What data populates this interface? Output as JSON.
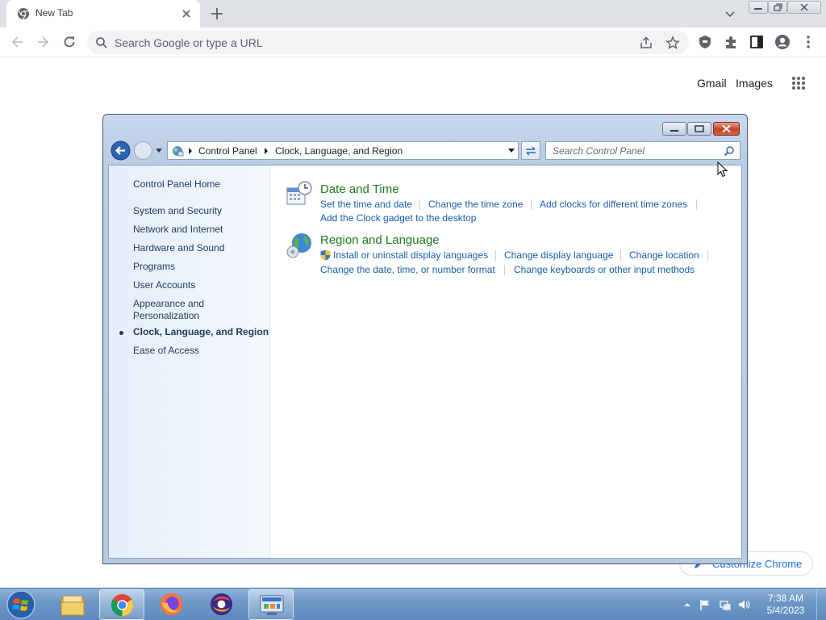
{
  "browser": {
    "tab": {
      "title": "New Tab",
      "favicon": "chrome-icon"
    },
    "omnibox": {
      "placeholder": "Search Google or type a URL"
    },
    "ntp": {
      "gmail": "Gmail",
      "images": "Images",
      "customize": "Customize Chrome"
    }
  },
  "cp": {
    "breadcrumb": [
      "Control Panel",
      "Clock, Language, and Region"
    ],
    "search_placeholder": "Search Control Panel",
    "sidebar": {
      "home": "Control Panel Home",
      "items": [
        "System and Security",
        "Network and Internet",
        "Hardware and Sound",
        "Programs",
        "User Accounts",
        "Appearance and",
        "Personalization",
        "Clock, Language, and Region",
        "Ease of Access"
      ]
    },
    "datetime": {
      "title": "Date and Time",
      "links": [
        "Set the time and date",
        "Change the time zone",
        "Add clocks for different time zones",
        "Add the Clock gadget to the desktop"
      ]
    },
    "region": {
      "title": "Region and Language",
      "links": [
        "Install or uninstall display languages",
        "Change display language",
        "Change location",
        "Change the date, time, or number format",
        "Change keyboards or other input methods"
      ]
    }
  },
  "taskbar": {
    "apps": [
      "file-explorer-icon",
      "chrome-icon",
      "firefox-icon",
      "app-icon",
      "control-panel-icon"
    ],
    "time": "7:38 AM",
    "date": "5/4/2023"
  },
  "colors": {
    "link": "#1a5ea8",
    "category": "#1e7b1e",
    "sidebar_text": "#1e395b"
  }
}
